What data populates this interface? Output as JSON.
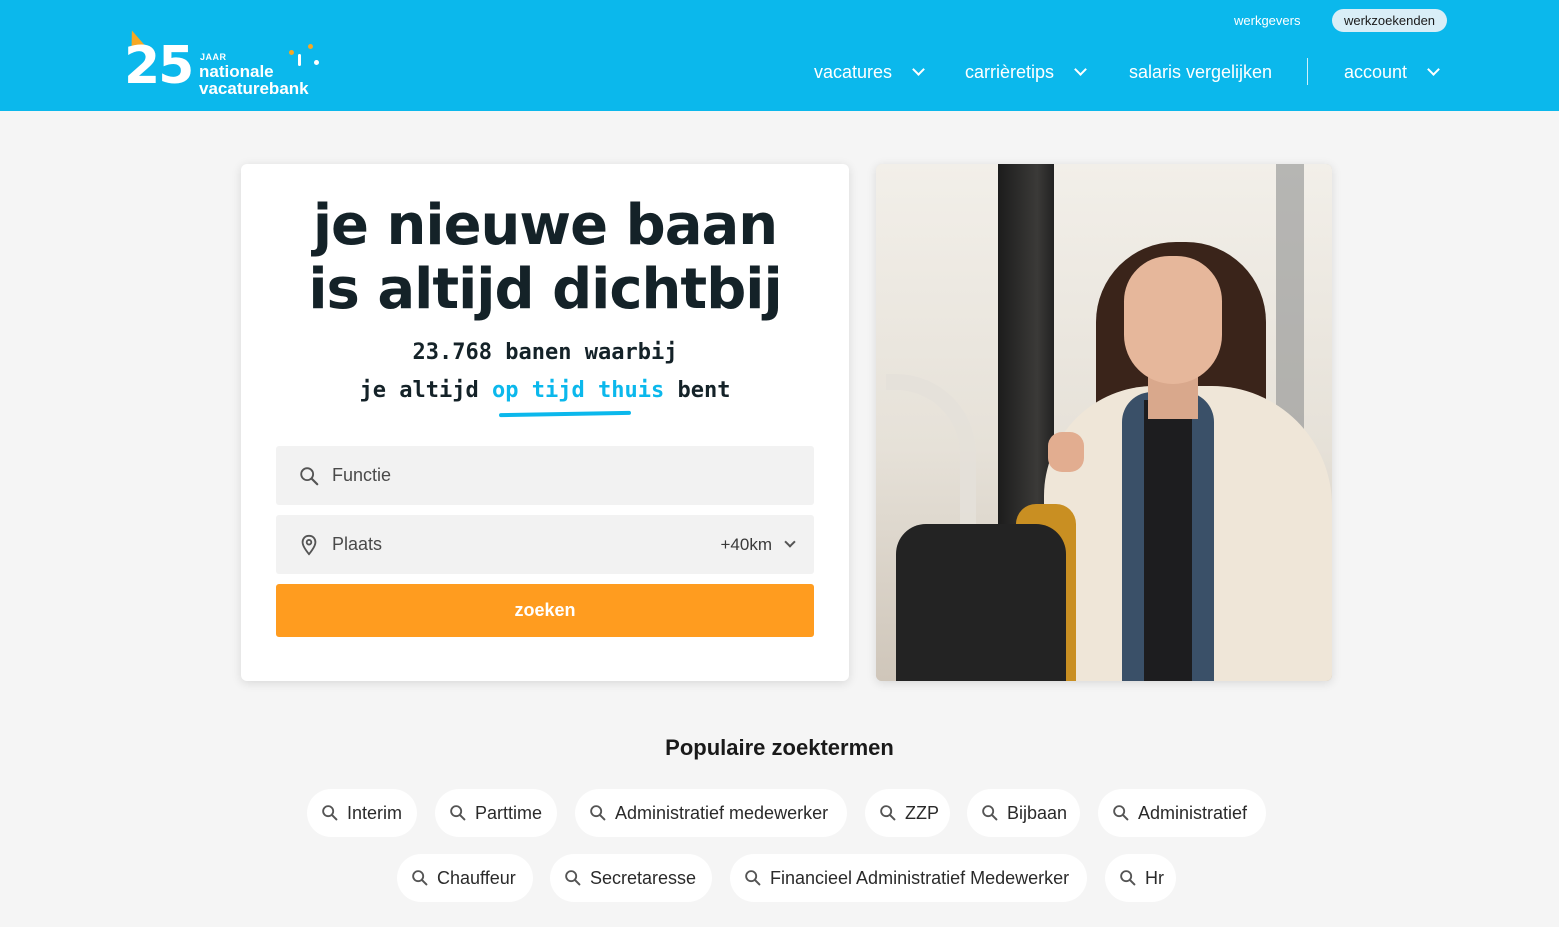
{
  "header": {
    "logo": {
      "number": "25",
      "jaar": "JAAR",
      "line1": "nationale",
      "line2": "vacaturebank"
    },
    "top_links": {
      "werkgevers": "werkgevers",
      "werkzoekenden": "werkzoekenden"
    },
    "nav": {
      "vacatures": "vacatures",
      "carrieretips": "carrièretips",
      "salaris": "salaris vergelijken",
      "account": "account"
    },
    "colors": {
      "brand": "#0bb8ec",
      "accent": "#ff9c1f"
    }
  },
  "hero": {
    "headline_line1": "je nieuwe baan",
    "headline_line2": "is altijd dichtbij",
    "tagline1": "23.768 banen waarbij",
    "tagline2_a": "je altijd",
    "tagline2_highlight": "op tijd thuis",
    "tagline2_b": "bent",
    "functie_placeholder": "Functie",
    "plaats_placeholder": "Plaats",
    "radius": "+40km",
    "search_button": "zoeken",
    "icons": {
      "functie": "search-icon",
      "plaats": "location-pin-icon"
    }
  },
  "popular": {
    "title": "Populaire zoektermen",
    "terms": [
      "Interim",
      "Parttime",
      "Administratief medewerker",
      "ZZP",
      "Bijbaan",
      "Administratief",
      "Chauffeur",
      "Secretaresse",
      "Financieel Administratief Medewerker",
      "Hr"
    ]
  }
}
